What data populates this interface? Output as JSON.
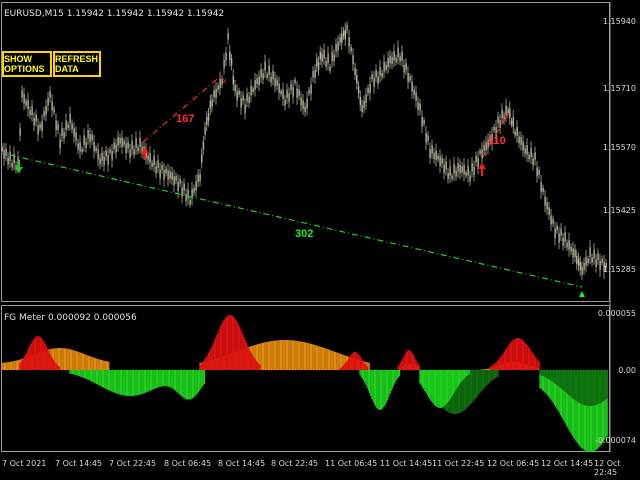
{
  "chart": {
    "symbol_header": "EURUSD,M15  1.15942 1.15942 1.15942 1.15942",
    "price_labels": [
      "1.15940",
      "1.15710",
      "1.15570",
      "1.15425",
      "1.15285"
    ],
    "buttons": {
      "show_options": "SHOW OPTIONS",
      "refresh_data": "REFRESH DATA"
    },
    "annotations": {
      "leg_small": "167",
      "leg_long": "302",
      "leg_right": "110"
    },
    "colors": {
      "up_arrow": "#ff0000",
      "down_arrow": "#22cc22",
      "trend_up": "#ff2a2a",
      "trend_down": "#18d818",
      "button_border": "#ffd400",
      "button_text": "#ffff00"
    },
    "icons": [
      "down-arrow-icon",
      "up-arrow-icon",
      "triangle-marker-icon"
    ]
  },
  "indicator": {
    "header": "FG Meter 0.000092 0.000056",
    "value_labels": [
      "0.000055",
      "0.00",
      "-0.000074"
    ],
    "colors": {
      "positive_high": "#dd1111",
      "positive": "#e08a10",
      "negative": "#1fd01f",
      "negative_deep": "#0f6f0f"
    }
  },
  "time_axis": {
    "labels": [
      "7 Oct 2021",
      "7 Oct 14:45",
      "7 Oct 22:45",
      "8 Oct 06:45",
      "8 Oct 14:45",
      "8 Oct 22:45",
      "11 Oct 06:45",
      "11 Oct 14:45",
      "11 Oct 22:45",
      "12 Oct 06:45",
      "12 Oct 14:45",
      "12 Oct 22:45"
    ]
  }
}
